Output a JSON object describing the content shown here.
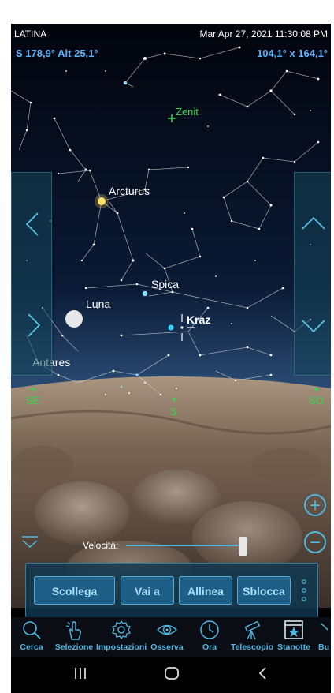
{
  "status": {
    "location": "LATINA",
    "datetime": "Mar Apr 27, 2021 11:30:08 PM"
  },
  "hud": {
    "direction": "S 178,9° Alt 25,1°",
    "fov": "104,1° x 164,1°"
  },
  "sky_labels": {
    "zenith": "Zenit",
    "arcturus": "Arcturus",
    "spica": "Spica",
    "moon": "Luna",
    "kraz": "Kraz",
    "antares": "Antares"
  },
  "compass": {
    "se": "SE",
    "s": "S",
    "so": "SO"
  },
  "speed": {
    "label": "Velocità:",
    "value": 0.95
  },
  "commands": {
    "scollega": "Scollega",
    "vai_a": "Vai a",
    "allinea": "Allinea",
    "sblocca": "Sblocca"
  },
  "toolbar": {
    "cerca": "Cerca",
    "selezione": "Selezione",
    "impostazioni": "Impostazioni",
    "osserva": "Osserva",
    "ora": "Ora",
    "telescopio": "Telescopio",
    "stanotte": "Stanotte",
    "bu": "Bu"
  },
  "colors": {
    "accent": "#4fb7e0",
    "hud_blue": "#5ab4ff",
    "compass_green": "#33d84a"
  }
}
